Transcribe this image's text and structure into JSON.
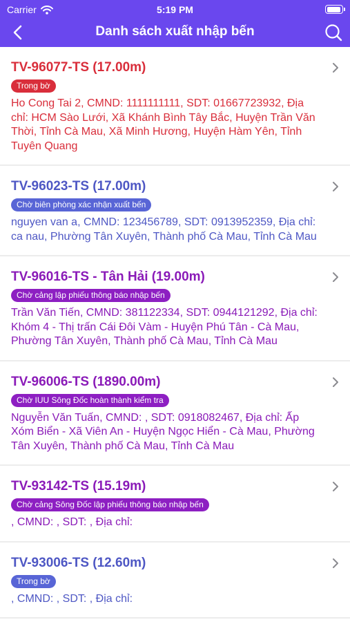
{
  "status_bar": {
    "carrier": "Carrier",
    "time": "5:19 PM"
  },
  "header": {
    "title": "Danh sách xuất nhập bến",
    "back_icon": "back-arrow-icon",
    "search_icon": "search-icon"
  },
  "colors": {
    "header_bg": "#6a47ee",
    "red": "#d92e3b",
    "blue": "#4e57c4",
    "purple": "#8a1ab8"
  },
  "items": [
    {
      "title": "TV-96077-TS (17.00m)",
      "badge": "Trong bờ",
      "desc": "Ho Cong Tai 2, CMND: 1111111111, SDT: 01667723932, Địa chỉ: HCM Sào Lưới, Xã Khánh Bình Tây Bắc, Huyện Trần Văn Thời, Tỉnh Cà Mau, Xã Minh Hương, Huyện Hàm Yên, Tỉnh Tuyên Quang",
      "color": "#d92e3b",
      "badge_bg": "#d92e3b"
    },
    {
      "title": "TV-96023-TS (17.00m)",
      "badge": "Chờ biên phòng xác nhận xuất bến",
      "desc": "nguyen van a, CMND: 123456789, SDT: 0913952359, Địa chỉ: ca nau, Phường Tân Xuyên, Thành phố Cà Mau, Tỉnh Cà Mau",
      "color": "#4e57c4",
      "badge_bg": "#5865d6"
    },
    {
      "title": "TV-96016-TS - Tân Hải (19.00m)",
      "badge": "Chờ cảng  lập phiếu thông báo nhập bến",
      "desc": "Trần Văn Tiến, CMND: 381122334, SDT: 0944121292, Địa chỉ: Khóm 4 - Thị trấn Cái Đôi Vàm - Huyện Phú Tân - Cà Mau, Phường Tân Xuyên, Thành phố Cà Mau, Tỉnh Cà Mau",
      "color": "#8a1ab8",
      "badge_bg": "#8d1fc2"
    },
    {
      "title": "TV-96006-TS (1890.00m)",
      "badge": "Chờ IUU Sông Đốc hoàn thành kiểm tra",
      "desc": "Nguyễn Văn Tuấn, CMND: , SDT: 0918082467, Địa chỉ: Ấp Xóm Biển - Xã Viên An - Huyện Ngọc Hiển - Cà Mau, Phường Tân Xuyên, Thành phố Cà Mau, Tỉnh Cà Mau",
      "color": "#8a1ab8",
      "badge_bg": "#8d1fc2"
    },
    {
      "title": "TV-93142-TS (15.19m)",
      "badge": "Chờ cảng Sông Đốc lập phiếu thông báo nhập bến",
      "desc": ", CMND: , SDT: , Địa chỉ:",
      "color": "#8a1ab8",
      "badge_bg": "#8d1fc2"
    },
    {
      "title": "TV-93006-TS (12.60m)",
      "badge": "Trong bờ",
      "desc": ", CMND: , SDT: , Địa chỉ:",
      "color": "#4e57c4",
      "badge_bg": "#5865d6"
    }
  ]
}
